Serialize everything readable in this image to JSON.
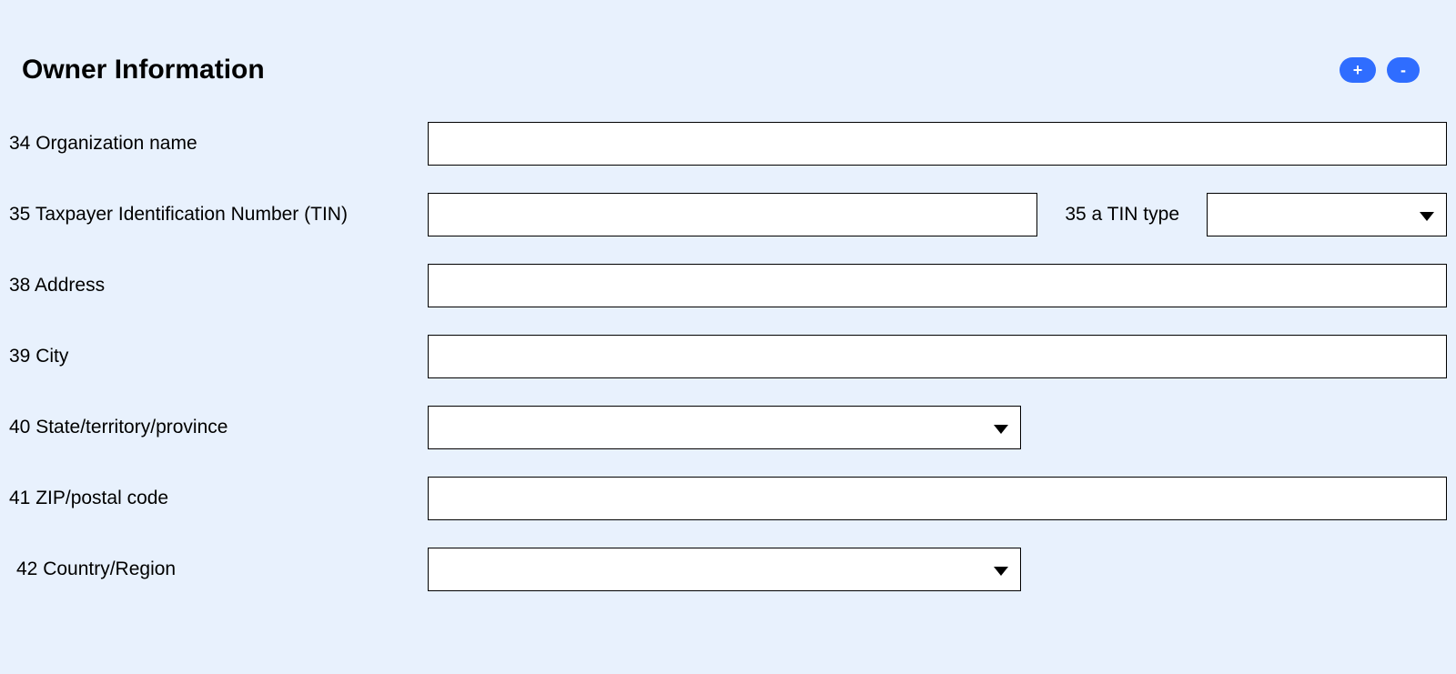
{
  "header": {
    "title": "Owner Information",
    "add_label": "+",
    "remove_label": "-"
  },
  "fields": {
    "org_name": {
      "label": "34 Organization name",
      "value": ""
    },
    "tin": {
      "label": "35 Taxpayer Identification Number (TIN)",
      "value": ""
    },
    "tin_type": {
      "label": "35 a TIN type",
      "value": ""
    },
    "address": {
      "label": "38  Address",
      "value": ""
    },
    "city": {
      "label": "39  City",
      "value": ""
    },
    "state": {
      "label": "40 State/territory/province",
      "value": ""
    },
    "zip": {
      "label": "41 ZIP/postal code",
      "value": ""
    },
    "country": {
      "label": "42 Country/Region",
      "value": ""
    }
  }
}
